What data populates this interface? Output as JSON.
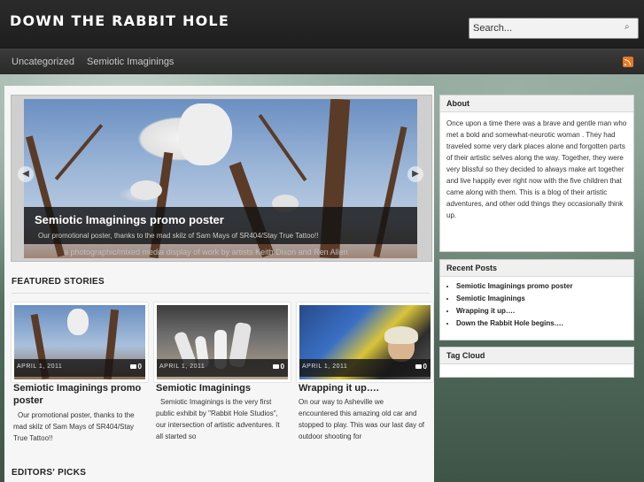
{
  "site": {
    "title": "DOWN THE RABBIT HOLE"
  },
  "search": {
    "placeholder": "Search...",
    "icon": "magnifier-icon"
  },
  "nav": {
    "items": [
      "Uncategorized",
      "Semiotic Imaginings"
    ],
    "feed_icon": "rss-icon"
  },
  "slider": {
    "title": "Semiotic Imaginings promo poster",
    "text": "Our promotional poster, thanks to the mad skilz of Sam Mays of SR404/Stay True Tattoo!!",
    "description": "a photographic/mixed media display of work by artists Keith Dixon and Ren Allen",
    "prev_icon": "chevron-left-icon",
    "next_icon": "chevron-right-icon"
  },
  "featured": {
    "heading": "FEATURED STORIES",
    "stories": [
      {
        "date": "APRIL 1, 2011",
        "comments": "0",
        "title": "Semiotic Imaginings promo poster",
        "excerpt": "Our promotional poster, thanks to the mad skilz of Sam Mays of SR404/Stay True Tattoo!!"
      },
      {
        "date": "APRIL 1, 2011",
        "comments": "0",
        "title": "Semiotic Imaginings",
        "excerpt": "Semiotic Imaginings is the very first public exhibit by \"Rabbit Hole Studios\", our intersection of artistic adventures. It all started so"
      },
      {
        "date": "APRIL 1, 2011",
        "comments": "0",
        "title": "Wrapping it up….",
        "excerpt": "On our way to Asheville we encountered this amazing old car and stopped to play. This was our last day of outdoor shooting for"
      }
    ]
  },
  "editors": {
    "heading": "EDITORS' PICKS"
  },
  "sidebar": {
    "about": {
      "heading": "About",
      "text": "Once upon a time there was a brave and gentle man who met a bold and somewhat-neurotic woman . They had traveled some very dark places alone and forgotten parts of their artistic selves along the way. Together, they were very blissful so they decided to always make art together and live happily ever right now with the five children that came along with them. This is a blog of their artistic adventures, and other odd things they occasionally think up."
    },
    "recent": {
      "heading": "Recent Posts",
      "items": [
        "Semiotic Imaginings promo poster",
        "Semiotic Imaginings",
        "Wrapping it up….",
        "Down the Rabbit Hole begins…."
      ]
    },
    "tagcloud": {
      "heading": "Tag Cloud"
    }
  }
}
